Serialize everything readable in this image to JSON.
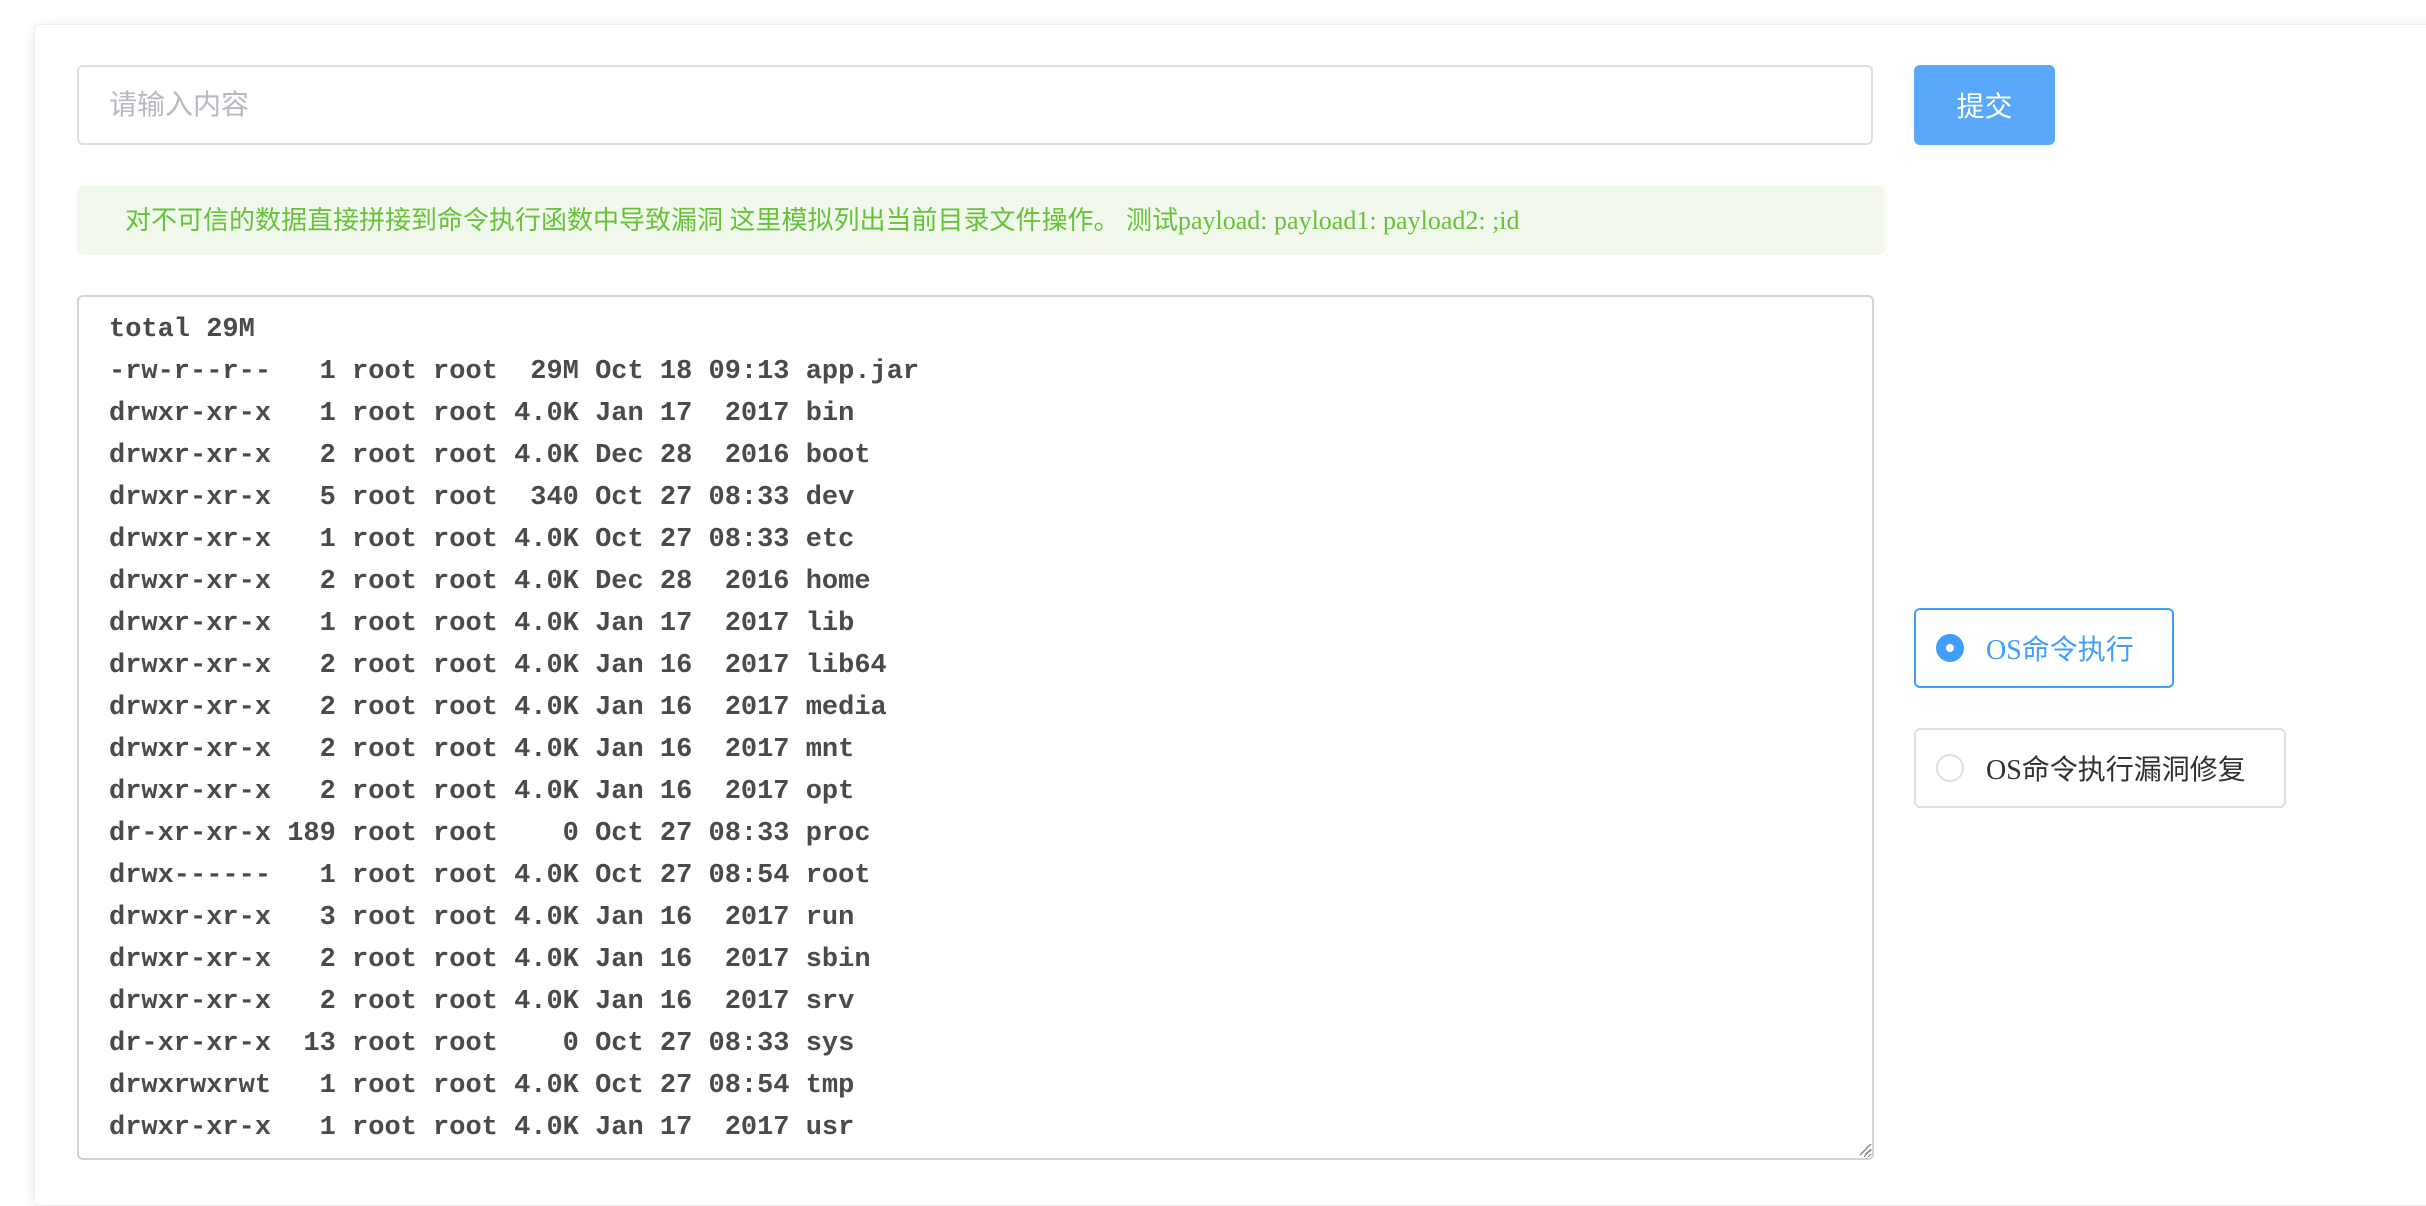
{
  "search": {
    "placeholder": "请输入内容",
    "value": ""
  },
  "submit_label": "提交",
  "alert_text": "对不可信的数据直接拼接到命令执行函数中导致漏洞 这里模拟列出当前目录文件操作。 测试payload: payload1: payload2: ;id",
  "output": {
    "lines": [
      "total 29M",
      "-rw-r--r--   1 root root  29M Oct 18 09:13 app.jar",
      "drwxr-xr-x   1 root root 4.0K Jan 17  2017 bin",
      "drwxr-xr-x   2 root root 4.0K Dec 28  2016 boot",
      "drwxr-xr-x   5 root root  340 Oct 27 08:33 dev",
      "drwxr-xr-x   1 root root 4.0K Oct 27 08:33 etc",
      "drwxr-xr-x   2 root root 4.0K Dec 28  2016 home",
      "drwxr-xr-x   1 root root 4.0K Jan 17  2017 lib",
      "drwxr-xr-x   2 root root 4.0K Jan 16  2017 lib64",
      "drwxr-xr-x   2 root root 4.0K Jan 16  2017 media",
      "drwxr-xr-x   2 root root 4.0K Jan 16  2017 mnt",
      "drwxr-xr-x   2 root root 4.0K Jan 16  2017 opt",
      "dr-xr-xr-x 189 root root    0 Oct 27 08:33 proc",
      "drwx------   1 root root 4.0K Oct 27 08:54 root",
      "drwxr-xr-x   3 root root 4.0K Jan 16  2017 run",
      "drwxr-xr-x   2 root root 4.0K Jan 16  2017 sbin",
      "drwxr-xr-x   2 root root 4.0K Jan 16  2017 srv",
      "dr-xr-xr-x  13 root root    0 Oct 27 08:33 sys",
      "drwxrwxrwt   1 root root 4.0K Oct 27 08:54 tmp",
      "drwxr-xr-x   1 root root 4.0K Jan 17  2017 usr"
    ]
  },
  "radios": [
    {
      "label": "OS命令执行",
      "checked": true
    },
    {
      "label": "OS命令执行漏洞修复",
      "checked": false
    }
  ],
  "colors": {
    "primary": "#409eff",
    "submit_bg": "#5aa8fb",
    "alert_bg": "#f0f9eb",
    "alert_text": "#67c23a"
  },
  "icons": {
    "resize_handle": "resize-grip-icon"
  }
}
